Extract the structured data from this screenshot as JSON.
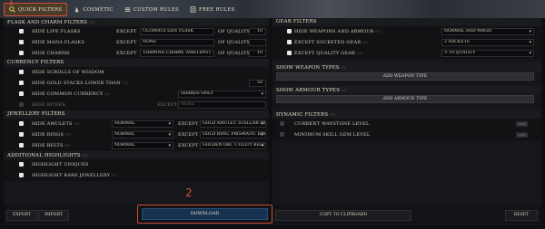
{
  "tabs": [
    {
      "label": "Quick Filters",
      "icon": "search-icon"
    },
    {
      "label": "Cosmetic",
      "icon": "cosmetic-icon"
    },
    {
      "label": "Custom Rules",
      "icon": "list-icon"
    },
    {
      "label": "Free Rules",
      "icon": "free-rules-icon"
    }
  ],
  "markers": {
    "one": "1",
    "two": "2"
  },
  "left": {
    "flask": {
      "title": "Flask and Charm Filters",
      "help": "(?)",
      "rows": [
        {
          "label": "Hide Life Flasks",
          "except": "Except",
          "value": "Ultimate Life Flask",
          "quality_label": "Of Quality",
          "quality": "10"
        },
        {
          "label": "Hide Mana Flasks",
          "except": "Except",
          "value": "None",
          "quality_label": "Of Quality",
          "quality": ""
        },
        {
          "label": "Hide Charms",
          "except": "Except",
          "value": "Thawing Charm, Amethyst ...",
          "quality_label": "Of Quality",
          "quality": "10"
        }
      ]
    },
    "currency": {
      "title": "Currency Filters",
      "scrolls": "Hide Scrolls of Wisdom",
      "gold": "Hide Gold Stacks Lower Than",
      "gold_help": "(?)",
      "gold_value": "50",
      "common": "Hide Common Currency",
      "common_help": "(?)",
      "common_value": "Shards Only",
      "runes": "Hide Runes",
      "runes_except": "Except",
      "runes_value": "None"
    },
    "jewellery": {
      "title": "Jewellery Filters",
      "rows": [
        {
          "label": "Hide Amulets",
          "help": "(?)",
          "rarity": "Normal",
          "except": "Except",
          "value": "Gold Amulet, Stellar Amu..."
        },
        {
          "label": "Hide Rings",
          "help": "(?)",
          "rarity": "Normal",
          "except": "Except",
          "value": "Gold Ring, Prismatic Ring..."
        },
        {
          "label": "Hide Belts",
          "help": "(?)",
          "rarity": "Normal",
          "except": "Except",
          "value": "Golden Obi, Utility Belt"
        }
      ]
    },
    "highlights": {
      "title": "Additional Highlights",
      "help": "(?)",
      "uniques": "Highlight Uniques",
      "rare_jewellery": "Highlight Rare Jewellery",
      "rare_help": "(?)"
    }
  },
  "right": {
    "gear": {
      "title": "Gear Filters",
      "rows": [
        {
          "label": "Hide Weapons and Armour",
          "help": "(?)",
          "value": "Normal and Magic"
        },
        {
          "label": "Except Socketed Gear",
          "help": "(?)",
          "value": "2 Sockets"
        },
        {
          "label": "Except Quality Gear",
          "help": "(?)",
          "value": "> 10 Quality"
        }
      ]
    },
    "weapon_types": {
      "title": "Show Weapon Types",
      "help": "(?)",
      "button": "Add Weapon Type"
    },
    "armour_types": {
      "title": "Show Armour Types",
      "help": "(?)",
      "button": "Add Armour Type"
    },
    "dynamic": {
      "title": "Dynamic Filters",
      "help": "(?)",
      "rows": [
        {
          "label": "Current Waystone Level",
          "button": "apply"
        },
        {
          "label": "Minimum Skill Gem Level",
          "button": "apply"
        }
      ]
    }
  },
  "footer": {
    "export": "Export",
    "import": "Import",
    "download": "Download",
    "copy": "Copy to Clipboard",
    "reset": "Reset"
  }
}
